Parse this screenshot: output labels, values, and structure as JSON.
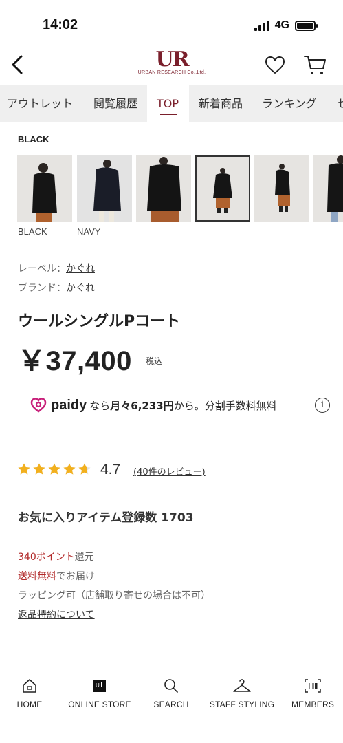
{
  "status_bar": {
    "time": "14:02",
    "network": "4G"
  },
  "header": {
    "logo_mark": "UR",
    "logo_text": "URBAN RESEARCH Co.,Ltd."
  },
  "tabs": [
    {
      "label": "アウトレット"
    },
    {
      "label": "閲覧履歴"
    },
    {
      "label": "TOP"
    },
    {
      "label": "新着商品"
    },
    {
      "label": "ランキング"
    },
    {
      "label": "セ"
    }
  ],
  "active_tab": "TOP",
  "color_section": {
    "selected_color": "BLACK",
    "swatch_labels": [
      "BLACK",
      "NAVY"
    ]
  },
  "meta": {
    "label_key": "レーベル：",
    "label_value": "かぐれ",
    "brand_key": "ブランド：",
    "brand_value": "かぐれ"
  },
  "product": {
    "title": "ウールシングルPコート",
    "price": "￥37,400",
    "tax_note": "税込"
  },
  "paidy": {
    "brand": "paidy",
    "text_prefix": "なら",
    "text_monthly": "月々6,233円",
    "text_suffix": "から。分割手数料無料",
    "info_symbol": "i",
    "accent_color": "#c8207a"
  },
  "rating": {
    "value": "4.7",
    "stars": 4.7,
    "reviews_link": "(40件のレビュー)"
  },
  "favorites": {
    "text": "お気に入りアイテム登録数 1703"
  },
  "benefits": {
    "points_red": "340ポイント",
    "points_rest": "還元",
    "shipping_red": "送料無料",
    "shipping_rest": "でお届け",
    "wrapping": "ラッピング可（店舗取り寄せの場合は不可）",
    "returns_link": "返品特約について"
  },
  "bottom_nav": [
    {
      "label": "HOME",
      "icon": "home-icon"
    },
    {
      "label": "ONLINE STORE",
      "icon": "store-icon"
    },
    {
      "label": "SEARCH",
      "icon": "search-icon"
    },
    {
      "label": "STAFF STYLING",
      "icon": "hanger-icon"
    },
    {
      "label": "MEMBERS",
      "icon": "barcode-icon"
    }
  ],
  "colors": {
    "brand": "#7a1f2b",
    "red_text": "#b22a2a",
    "star": "#f2b01e",
    "tab_bg": "#efefef"
  }
}
